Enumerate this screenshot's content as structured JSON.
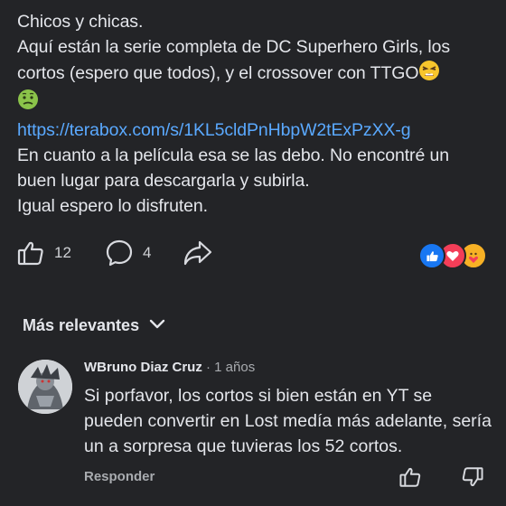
{
  "post": {
    "greeting": "Chicos y chicas.",
    "line1_prefix": "Aquí están la serie completa de DC Superhero Girls, los cortos (espero que todos), y el crossover con TTGO",
    "link": "https://terabox.com/s/1KL5cldPnHbpW2tExPzXX-g",
    "line3": "En cuanto a la película esa se las debo. No encontré un buen lugar para descargarla y subirla.",
    "line4": "Igual espero lo disfruten.",
    "emojis": [
      "tired-face-emoji",
      "nauseated-face-emoji"
    ]
  },
  "actions": {
    "like_count": "12",
    "comment_count": "4",
    "icons": [
      "like-icon",
      "comment-icon",
      "share-icon"
    ],
    "reaction_icons": [
      "like-reaction-icon",
      "love-reaction-icon",
      "care-reaction-icon"
    ],
    "colors": {
      "like": "#1877f2",
      "love": "#f33e58",
      "care": "#f7b125"
    }
  },
  "comments_header": {
    "sort_label": "Más relevantes"
  },
  "comment": {
    "author": "WBruno Diaz Cruz",
    "time": "· 1 años",
    "text": "Si porfavor, los cortos si bien están en YT se pueden convertir en Lost medía más adelante, sería un a sorpresa que tuvieras los 52 cortos.",
    "reply_label": "Responder"
  }
}
